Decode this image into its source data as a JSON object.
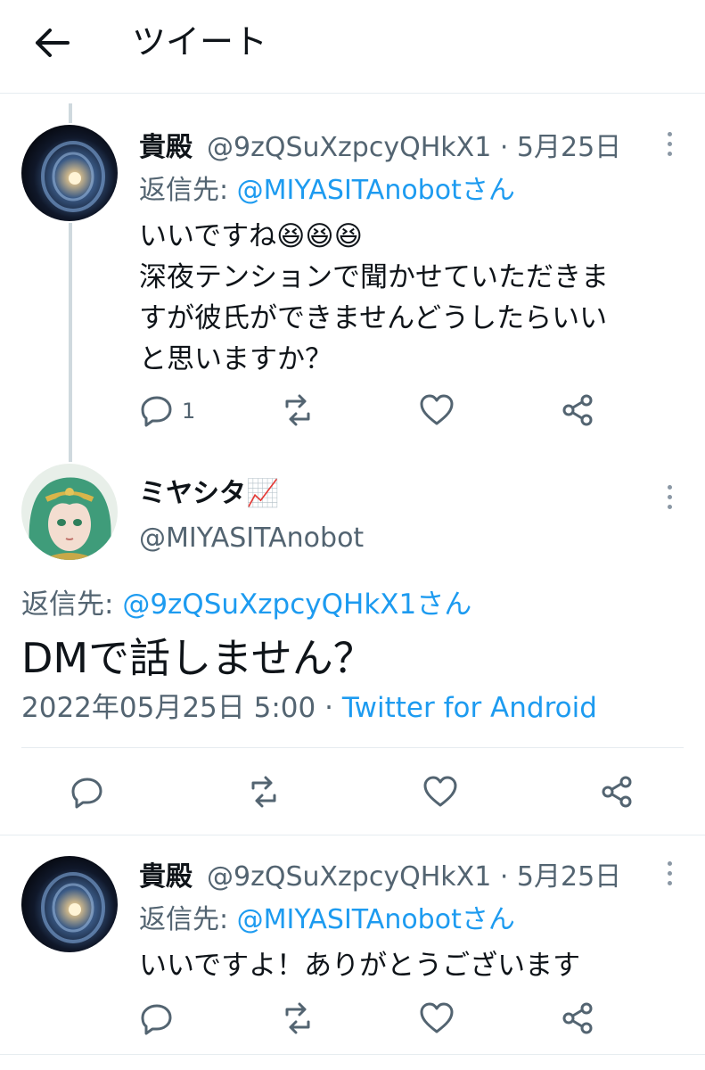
{
  "header": {
    "title": "ツイート"
  },
  "tweets": [
    {
      "name": "貴殿",
      "handle": "@9zQSuXzpcyQHkX1",
      "date": "· 5月25日",
      "reply_prefix": "返信先: ",
      "reply_user": "@MIYASITAnobotさん",
      "lines": [
        "いいですね😆😆😆",
        "深夜テンションで聞かせていただきま",
        "すが彼氏ができませんどうしたらいい",
        "と思いますか？"
      ],
      "reply_count": "1"
    },
    {
      "name": "貴殿",
      "handle": "@9zQSuXzpcyQHkX1",
      "date": "· 5月25日",
      "reply_prefix": "返信先: ",
      "reply_user": "@MIYASITAnobotさん",
      "lines": [
        "いいですよ！ありがとうございます"
      ]
    }
  ],
  "main_tweet": {
    "name": "ミヤシタ",
    "name_emoji": "📈",
    "handle": "@MIYASITAnobot",
    "reply_prefix": "返信先: ",
    "reply_user": "@9zQSuXzpcyQHkX1さん",
    "text": "DMで話しません？",
    "timestamp": "2022年05月25日 5:00 · ",
    "source": "Twitter for Android"
  },
  "colors": {
    "link": "#1d9bf0",
    "secondary": "#536471",
    "divider": "#e6ecf0"
  }
}
